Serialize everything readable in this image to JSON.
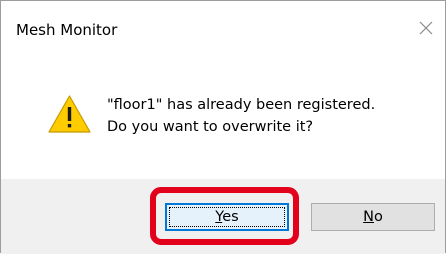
{
  "dialog": {
    "title": "Mesh Monitor",
    "close_icon": "close-icon",
    "warning_icon": "warning-icon",
    "message_line1": "\"floor1\" has already been registered.",
    "message_line2": "Do you want to overwrite it?",
    "yes_label_mnemonic": "Y",
    "yes_label_rest": "es",
    "no_label_mnemonic": "N",
    "no_label_rest": "o"
  },
  "colors": {
    "accent": "#0078d7",
    "highlight": "#e3001b",
    "warning": "#ffcc00",
    "footer": "#f0f0f0"
  }
}
